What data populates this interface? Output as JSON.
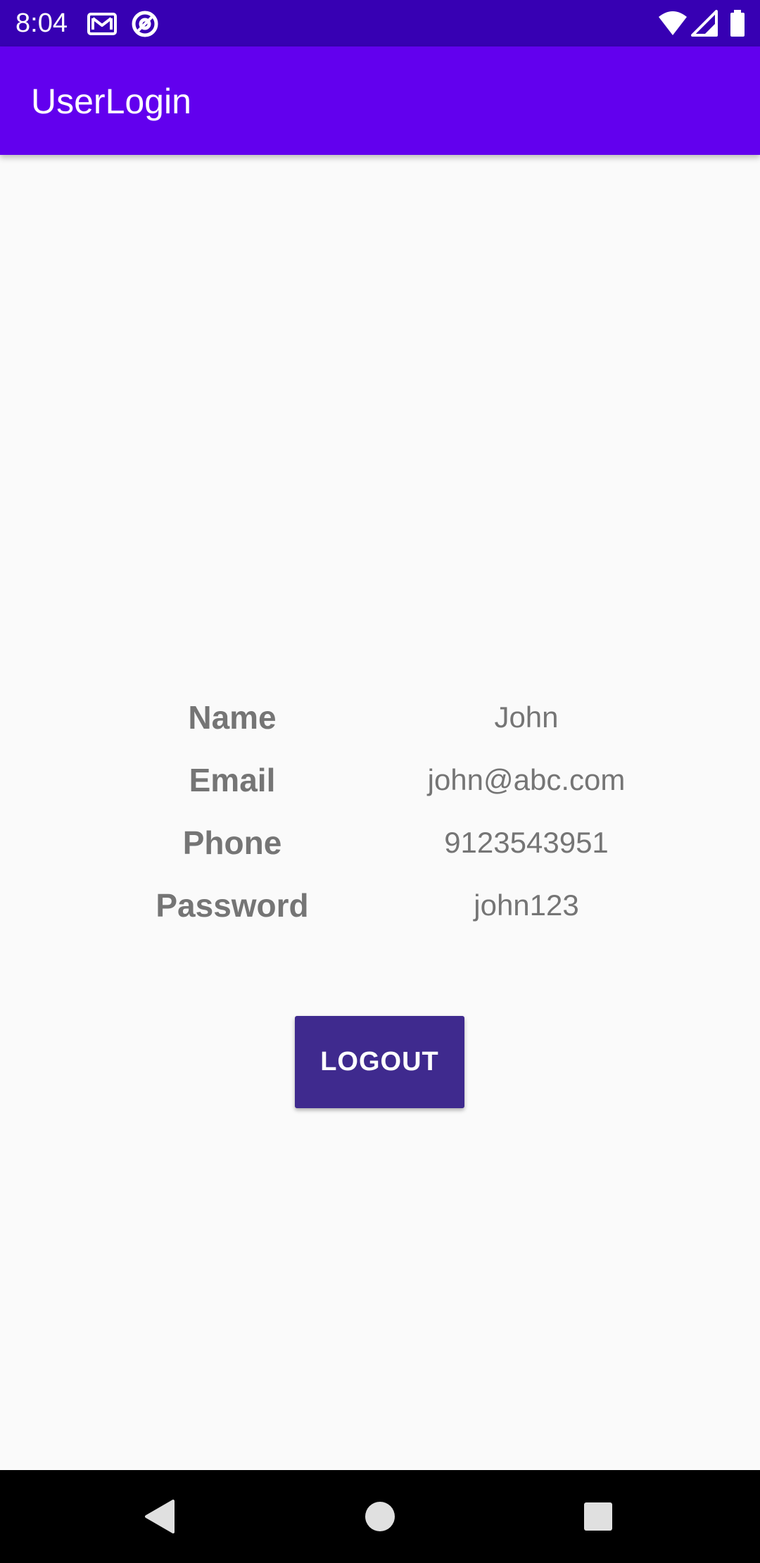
{
  "status_bar": {
    "time": "8:04",
    "icons": [
      "gmail-icon",
      "at-sign-icon",
      "wifi-icon",
      "signal-icon",
      "battery-icon"
    ]
  },
  "app_bar": {
    "title": "UserLogin"
  },
  "profile": {
    "rows": [
      {
        "label": "Name",
        "value": "John"
      },
      {
        "label": "Email",
        "value": "john@abc.com"
      },
      {
        "label": "Phone",
        "value": "9123543951"
      },
      {
        "label": "Password",
        "value": "john123"
      }
    ]
  },
  "actions": {
    "logout_label": "LOGOUT"
  },
  "nav_bar": {
    "icons": [
      "back-icon",
      "home-icon",
      "recents-icon"
    ]
  },
  "colors": {
    "status_bar": "#3700b3",
    "app_bar": "#6200ee",
    "button": "#3f2a8e",
    "text_gray": "#757575",
    "background": "#fafafa"
  }
}
